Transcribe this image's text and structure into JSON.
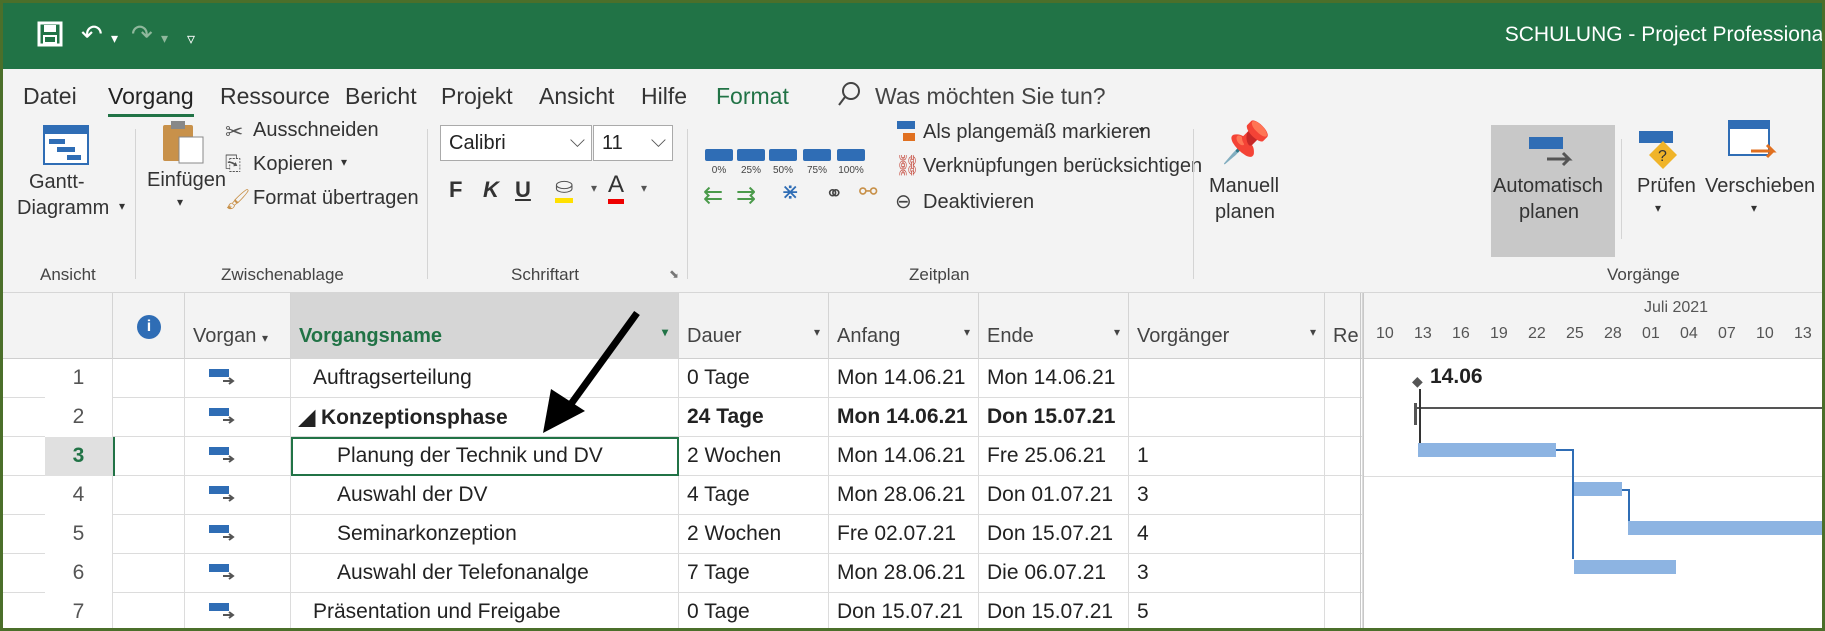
{
  "titlebar": {
    "title": "SCHULUNG  -  Project Professional"
  },
  "tabs": [
    {
      "label": "Datei"
    },
    {
      "label": "Vorgang"
    },
    {
      "label": "Ressource"
    },
    {
      "label": "Bericht"
    },
    {
      "label": "Projekt"
    },
    {
      "label": "Ansicht"
    },
    {
      "label": "Hilfe"
    },
    {
      "label": "Format"
    }
  ],
  "tellme": "Was möchten Sie tun?",
  "ribbon": {
    "ansicht": {
      "gantt_line1": "Gantt-",
      "gantt_line2": "Diagramm",
      "group": "Ansicht"
    },
    "clipboard": {
      "paste": "Einfügen",
      "cut": "Ausschneiden",
      "copy": "Kopieren",
      "format_painter": "Format übertragen",
      "group": "Zwischenablage"
    },
    "font": {
      "name": "Calibri",
      "size": "11",
      "bold": "F",
      "italic": "K",
      "underline": "U",
      "group": "Schriftart"
    },
    "schedule": {
      "pct": [
        "0%",
        "25%",
        "50%",
        "75%",
        "100%"
      ],
      "mark_on_track": "Als plangemäß markieren",
      "respect_links": "Verknüpfungen berücksichtigen",
      "inactivate": "Deaktivieren",
      "group": "Zeitplan"
    },
    "tasks": {
      "manual_1": "Manuell",
      "manual_2": "planen",
      "auto_1": "Automatisch",
      "auto_2": "planen",
      "inspect": "Prüfen",
      "move": "Verschieben",
      "group": "Vorgänge"
    }
  },
  "columns": {
    "info": "i",
    "mode": "Vorgan",
    "name": "Vorgangsname",
    "duration": "Dauer",
    "start": "Anfang",
    "finish": "Ende",
    "predecessors": "Vorgänger",
    "resources": "Re"
  },
  "rows": [
    {
      "id": "1",
      "name": "Auftragserteilung",
      "duration": "0 Tage",
      "start": "Mon 14.06.21",
      "finish": "Mon 14.06.21",
      "pred": ""
    },
    {
      "id": "2",
      "name": "◢ Konzeptionsphase",
      "duration": "24 Tage",
      "start": "Mon 14.06.21",
      "finish": "Don 15.07.21",
      "pred": ""
    },
    {
      "id": "3",
      "name": "Planung der Technik und DV",
      "duration": "2 Wochen",
      "start": "Mon 14.06.21",
      "finish": "Fre 25.06.21",
      "pred": "1"
    },
    {
      "id": "4",
      "name": "Auswahl der DV",
      "duration": "4 Tage",
      "start": "Mon 28.06.21",
      "finish": "Don 01.07.21",
      "pred": "3"
    },
    {
      "id": "5",
      "name": "Seminarkonzeption",
      "duration": "2 Wochen",
      "start": "Fre 02.07.21",
      "finish": "Don 15.07.21",
      "pred": "4"
    },
    {
      "id": "6",
      "name": "Auswahl der Telefonanalge",
      "duration": "7 Tage",
      "start": "Mon 28.06.21",
      "finish": "Die 06.07.21",
      "pred": "3"
    },
    {
      "id": "7",
      "name": "Präsentation und Freigabe",
      "duration": "0 Tage",
      "start": "Don 15.07.21",
      "finish": "Don 15.07.21",
      "pred": "5"
    }
  ],
  "gantt": {
    "month": "Juli 2021",
    "ticks": [
      "10",
      "13",
      "16",
      "19",
      "22",
      "25",
      "28",
      "01",
      "04",
      "07",
      "10",
      "13"
    ],
    "milestone_label": "14.06"
  },
  "colors": {
    "accent": "#217346",
    "bar": "#8db4e2",
    "link": "#2f6db5"
  }
}
